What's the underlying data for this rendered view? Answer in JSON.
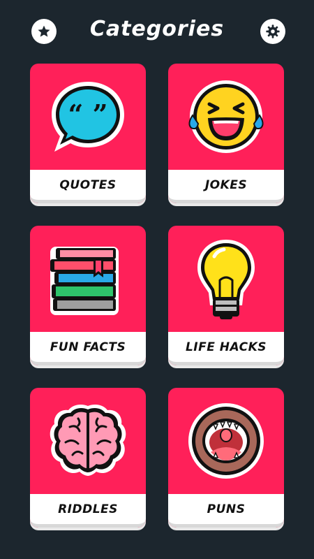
{
  "header": {
    "title": "Categories",
    "left_icon": "star-icon",
    "right_icon": "gear-icon"
  },
  "categories": [
    {
      "label": "QUOTES",
      "icon": "speech-bubble-quote-icon"
    },
    {
      "label": "JOKES",
      "icon": "laughing-emoji-icon"
    },
    {
      "label": "FUN FACTS",
      "icon": "book-stack-icon"
    },
    {
      "label": "LIFE HACKS",
      "icon": "light-bulb-icon"
    },
    {
      "label": "RIDDLES",
      "icon": "brain-icon"
    },
    {
      "label": "PUNS",
      "icon": "open-mouth-icon"
    }
  ],
  "colors": {
    "background": "#1c262e",
    "card": "#ff2059",
    "label_bar": "#ffffff"
  }
}
